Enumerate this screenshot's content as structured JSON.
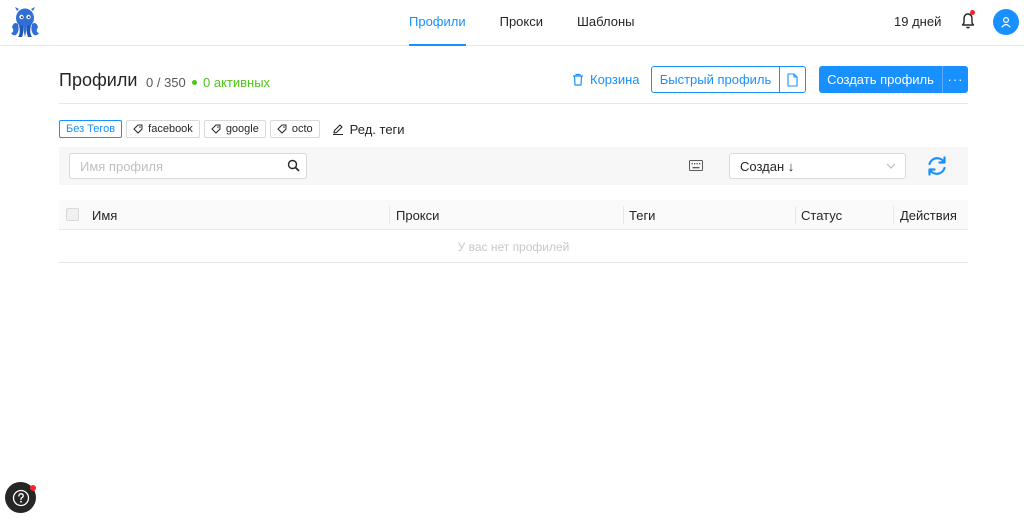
{
  "nav": {
    "tabs": [
      {
        "label": "Профили"
      },
      {
        "label": "Прокси"
      },
      {
        "label": "Шаблоны"
      }
    ],
    "days_left": "19 дней"
  },
  "header": {
    "title": "Профили",
    "count": "0 / 350",
    "active": "0 активных",
    "trash_label": "Корзина",
    "quick_profile_label": "Быстрый профиль",
    "create_profile_label": "Создать профиль",
    "more_label": "···"
  },
  "tags": {
    "items": [
      {
        "label": "Без Тегов",
        "selected": true
      },
      {
        "label": "facebook"
      },
      {
        "label": "google"
      },
      {
        "label": "octo"
      }
    ],
    "edit_label": "Ред. теги"
  },
  "filters": {
    "search_placeholder": "Имя профиля",
    "sort_value": "Создан ↓"
  },
  "table": {
    "columns": [
      "Имя",
      "Прокси",
      "Теги",
      "Статус",
      "Действия"
    ],
    "empty_text": "У вас нет профилей"
  },
  "colors": {
    "accent": "#1890ff",
    "active": "#52c41a",
    "notification": "#f5222d"
  },
  "icons": [
    "octopus-logo-icon",
    "bell-icon",
    "user-icon",
    "trash-icon",
    "file-icon",
    "tag-icon",
    "edit-icon",
    "search-icon",
    "keyboard-icon",
    "chevron-down-icon",
    "refresh-icon",
    "help-icon"
  ]
}
